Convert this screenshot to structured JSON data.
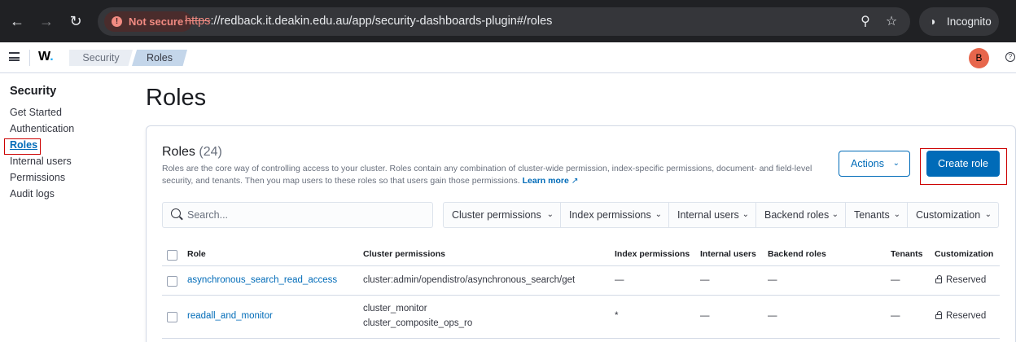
{
  "browser": {
    "not_secure_label": "Not secure",
    "url_scheme": "https",
    "url_rest": "://redback.it.deakin.edu.au/app/security-dashboards-plugin#/roles",
    "incognito_label": "Incognito"
  },
  "header": {
    "logo_letter": "W",
    "logo_dot": ".",
    "breadcrumbs": [
      "Security",
      "Roles"
    ],
    "avatar_initial": "B",
    "help_glyph": "?"
  },
  "sidebar": {
    "title": "Security",
    "items": [
      {
        "label": "Get Started"
      },
      {
        "label": "Authentication"
      },
      {
        "label": "Roles"
      },
      {
        "label": "Internal users"
      },
      {
        "label": "Permissions"
      },
      {
        "label": "Audit logs"
      }
    ]
  },
  "main": {
    "page_title": "Roles",
    "panel_title": "Roles",
    "panel_count": "(24)",
    "description": "Roles are the core way of controlling access to your cluster. Roles contain any combination of cluster-wide permission, index-specific permissions, document- and field-level security, and tenants. Then you map users to these roles so that users gain those permissions.",
    "learn_more": "Learn more",
    "actions_label": "Actions",
    "create_label": "Create role",
    "search_placeholder": "Search...",
    "filters": [
      "Cluster permissions",
      "Index permissions",
      "Internal users",
      "Backend roles",
      "Tenants",
      "Customization"
    ],
    "columns": [
      "Role",
      "Cluster permissions",
      "Index permissions",
      "Internal users",
      "Backend roles",
      "Tenants",
      "Customization"
    ],
    "rows": [
      {
        "role": "asynchronous_search_read_access",
        "cluster_permissions": [
          "cluster:admin/opendistro/asynchronous_search/get"
        ],
        "index_permissions": "—",
        "internal_users": "—",
        "backend_roles": "—",
        "tenants": "—",
        "customization": "Reserved"
      },
      {
        "role": "readall_and_monitor",
        "cluster_permissions": [
          "cluster_monitor",
          "cluster_composite_ops_ro"
        ],
        "index_permissions": "*",
        "internal_users": "—",
        "backend_roles": "—",
        "tenants": "—",
        "customization": "Reserved"
      }
    ]
  },
  "icons": {
    "back": "arrow-left-icon",
    "forward": "arrow-right-icon",
    "reload": "reload-icon",
    "zoom": "zoom-icon",
    "star": "star-icon",
    "search": "search-icon",
    "chevron": "chevron-down-icon",
    "lock": "lock-icon",
    "external": "external-link-icon"
  },
  "colors": {
    "primary": "#006bb8",
    "annotation_red": "#cc0000",
    "avatar": "#e7664c"
  }
}
